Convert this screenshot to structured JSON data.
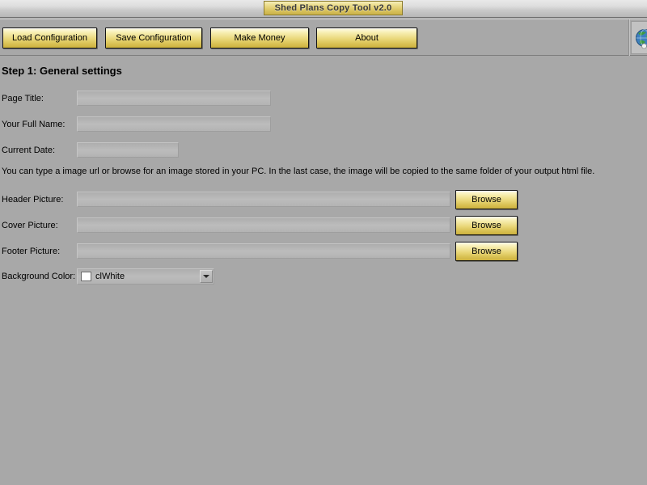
{
  "window": {
    "title": "Shed Plans Copy Tool v2.0"
  },
  "toolbar": {
    "buttons": [
      {
        "id": "load",
        "label": "Load Configuration"
      },
      {
        "id": "save",
        "label": "Save Configuration"
      },
      {
        "id": "money",
        "label": "Make Money"
      },
      {
        "id": "about",
        "label": "About"
      }
    ],
    "globe_icon": "globe-icon"
  },
  "main": {
    "step_title": "Step 1: General settings",
    "hint": "You can type a image url or browse for an image stored in your PC. In the last case, the image will be copied to the same folder of your output html file.",
    "fields": [
      {
        "id": "page_title",
        "label": "Page Title:",
        "value": "",
        "placeholder": ""
      },
      {
        "id": "full_name",
        "label": "Your Full Name:",
        "value": "",
        "placeholder": ""
      },
      {
        "id": "current_date",
        "label": "Current Date:",
        "value": "",
        "placeholder": ""
      },
      {
        "id": "header_picture",
        "label": "Header Picture:",
        "value": "",
        "placeholder": ""
      },
      {
        "id": "cover_picture",
        "label": "Cover Picture:",
        "value": "",
        "placeholder": ""
      },
      {
        "id": "footer_picture",
        "label": "Footer Picture:",
        "value": "",
        "placeholder": ""
      }
    ],
    "browse_label": "Browse",
    "background_color": {
      "label": "Background Color:",
      "value": "clWhite",
      "swatch_hex": "#ffffff"
    }
  },
  "colors": {
    "form_background": "#a8a8a8",
    "button_gold": "#e9d779",
    "title_plate_gold": "#e3d075"
  }
}
